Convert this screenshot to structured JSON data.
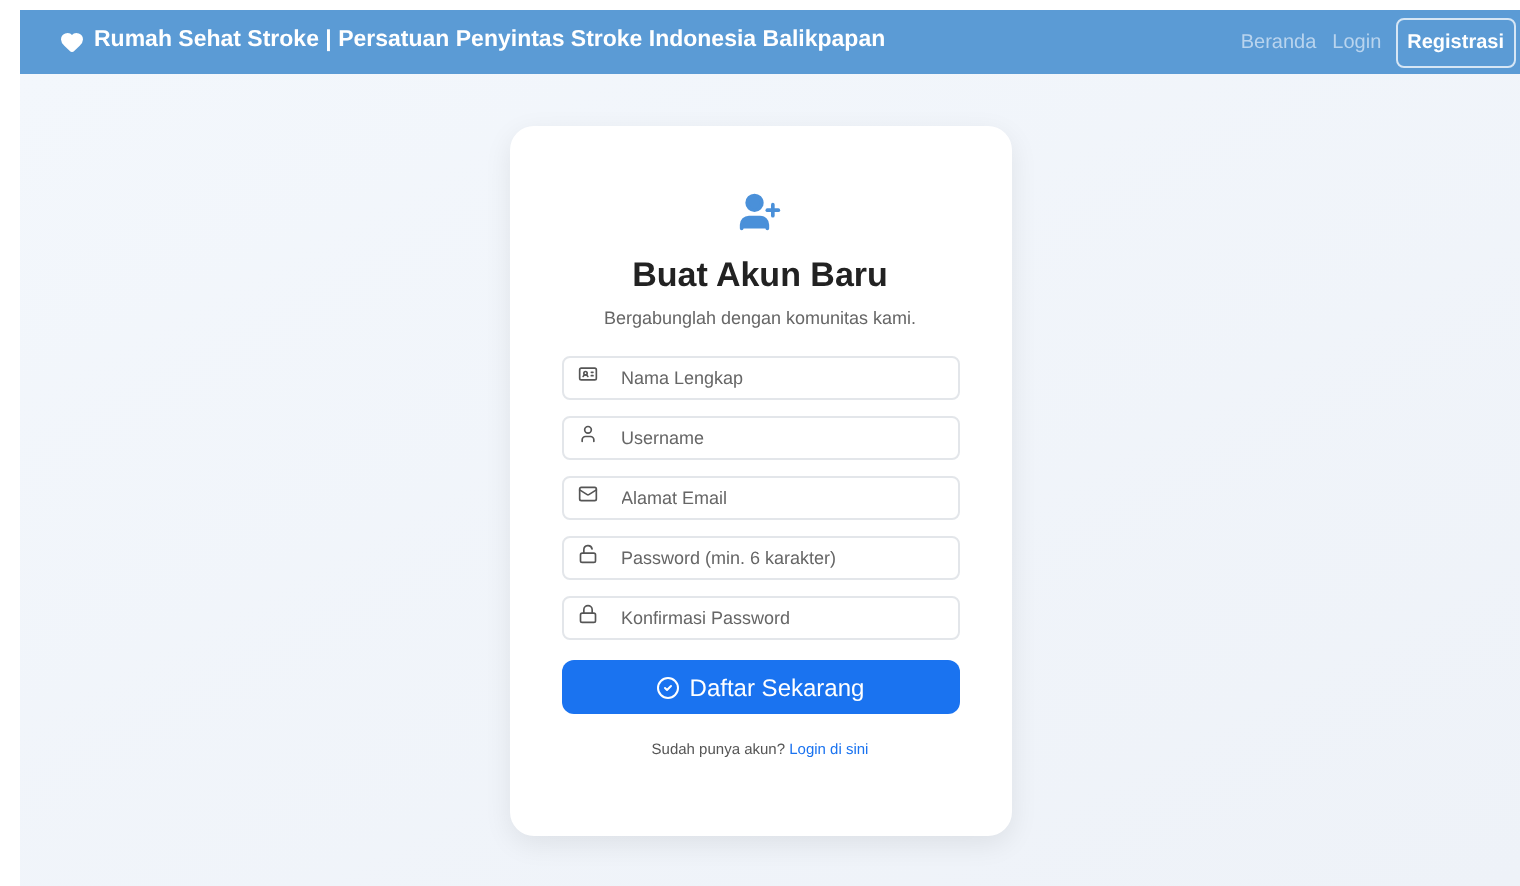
{
  "navbar": {
    "brand": "Rumah Sehat Stroke | Persatuan Penyintas Stroke Indonesia Balikpapan",
    "links": [
      {
        "label": "Beranda",
        "selected": false
      },
      {
        "label": "Login",
        "selected": false
      },
      {
        "label": "Registrasi",
        "selected": true
      }
    ]
  },
  "card": {
    "title": "Buat Akun Baru",
    "subtitle": "Bergabunglah dengan komunitas kami.",
    "fields": [
      {
        "kind": "id-card",
        "placeholder": "Nama Lengkap"
      },
      {
        "kind": "user",
        "placeholder": "Username"
      },
      {
        "kind": "email",
        "placeholder": "Alamat Email"
      },
      {
        "kind": "lock-open",
        "placeholder": "Password (min. 6 karakter)"
      },
      {
        "kind": "lock",
        "placeholder": "Konfirmasi Password"
      }
    ],
    "submit": "Daftar Sekarang",
    "footer_text": "Sudah punya akun?",
    "footer_link": "Login di sini"
  }
}
